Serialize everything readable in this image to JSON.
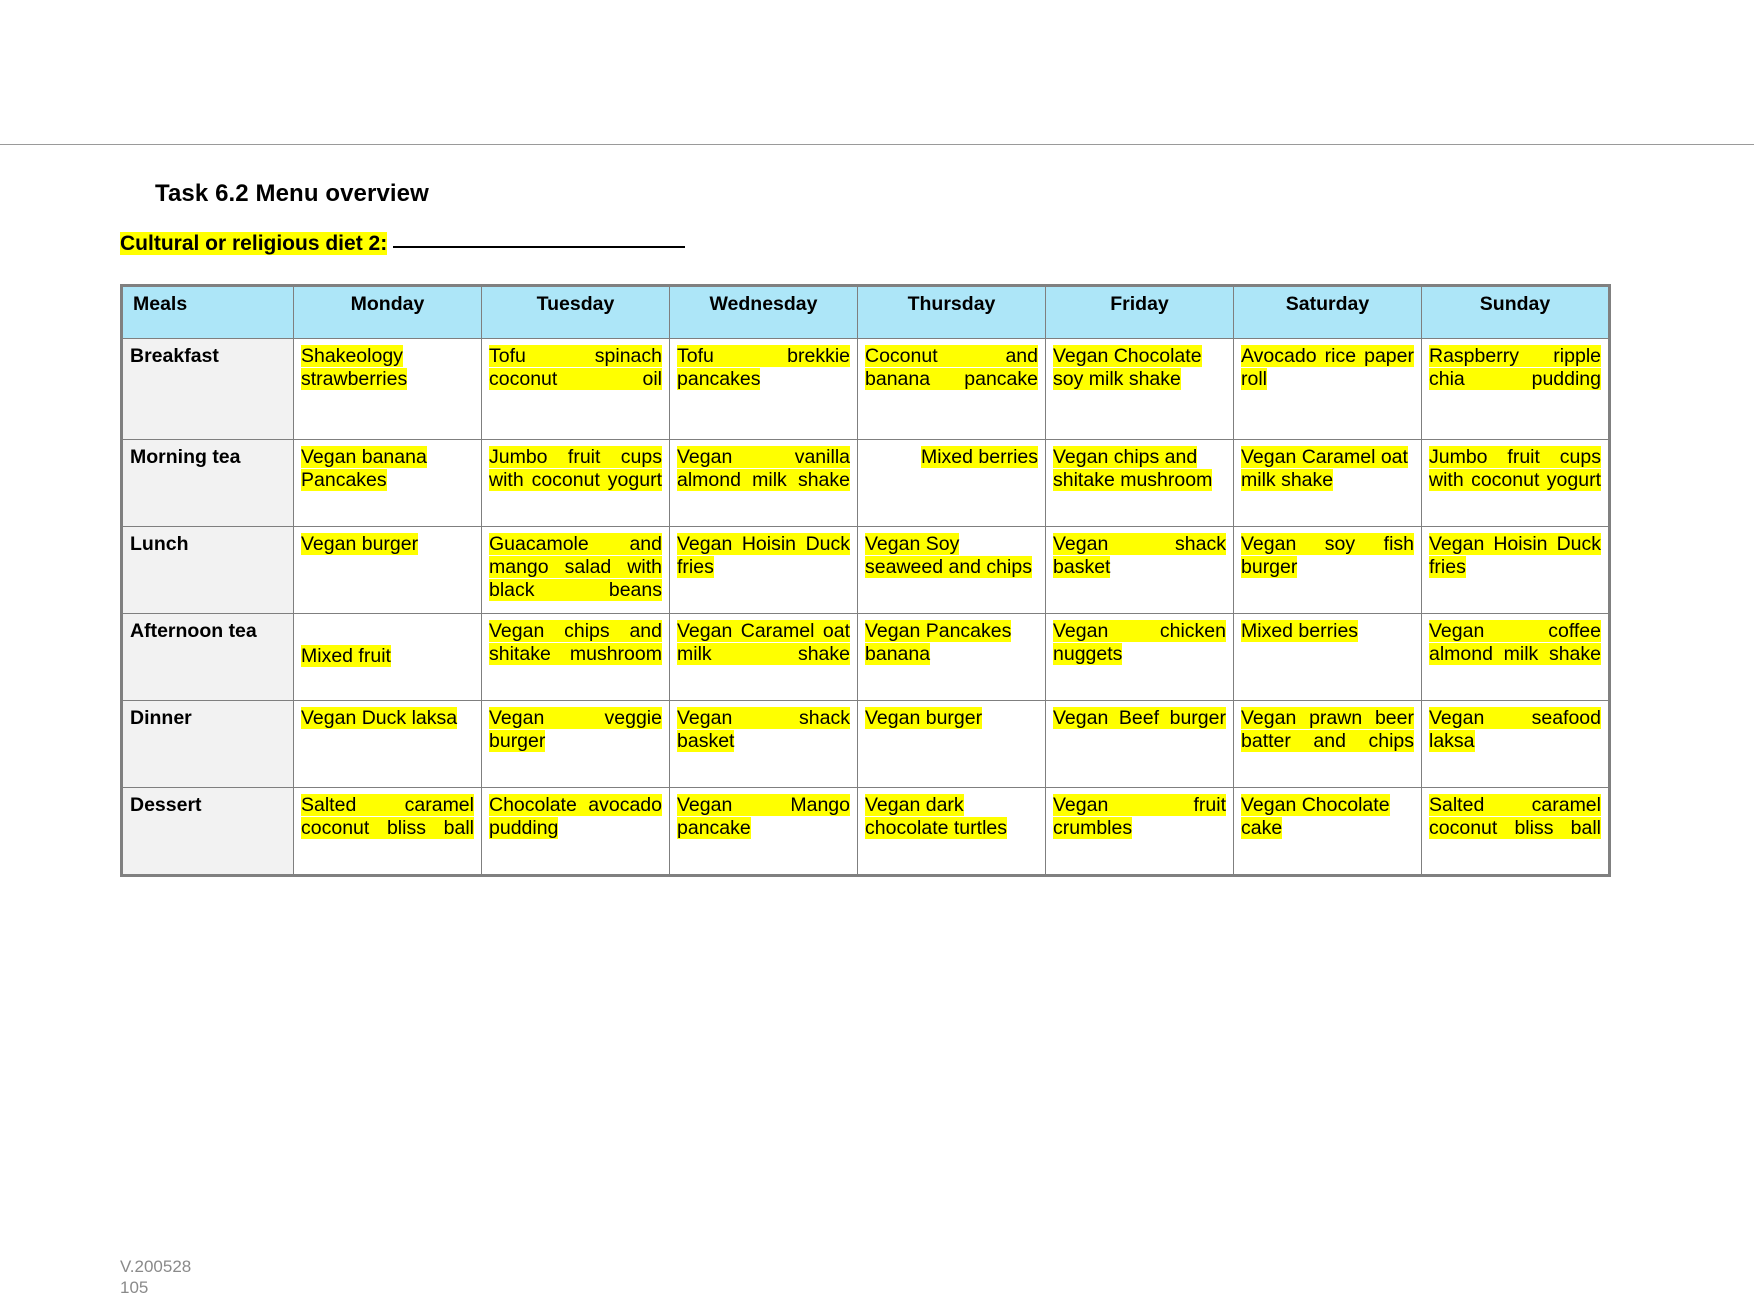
{
  "document": {
    "task_title": "Task 6.2 Menu overview",
    "diet_label": "Cultural or religious diet 2:",
    "diet_value": "",
    "footer_version": "V.200528",
    "footer_page": "105"
  },
  "colors": {
    "header_fill": "#ade6f8",
    "meal_label_fill": "#f2f2f2",
    "highlight": "#ffff00",
    "table_border": "#7f7f7f",
    "table_outer_border": "#808080",
    "footer_text": "#8a8a8a"
  },
  "table": {
    "columns": [
      "Meals",
      "Monday",
      "Tuesday",
      "Wednesday",
      "Thursday",
      "Friday",
      "Saturday",
      "Sunday"
    ],
    "rows": [
      {
        "meal": "Breakfast",
        "cells": [
          "Shakeology strawberries",
          "Tofu spinach coconut oil",
          "Tofu brekkie pancakes",
          "Coconut and banana pancake",
          "Vegan Chocolate soy milk shake",
          "Avocado rice paper roll",
          "Raspberry ripple chia pudding"
        ]
      },
      {
        "meal": "Morning tea",
        "cells": [
          "Vegan banana Pancakes",
          "Jumbo fruit cups with coconut yogurt",
          "Vegan vanilla almond milk shake",
          "Mixed berries",
          "Vegan chips and shitake mushroom",
          "Vegan Caramel oat milk shake",
          "Jumbo fruit cups with coconut yogurt"
        ]
      },
      {
        "meal": "Lunch",
        "cells": [
          "Vegan burger",
          "Guacamole and mango salad with black beans",
          "Vegan Hoisin Duck fries",
          "Vegan Soy seaweed and chips",
          "Vegan shack basket",
          "Vegan soy fish burger",
          "Vegan Hoisin Duck fries"
        ]
      },
      {
        "meal": "Afternoon tea",
        "cells": [
          "Mixed fruit",
          "Vegan chips and shitake mushroom",
          "Vegan Caramel oat milk shake",
          "Vegan Pancakes banana",
          "Vegan chicken nuggets",
          "Mixed berries",
          "Vegan coffee almond milk shake"
        ]
      },
      {
        "meal": "Dinner",
        "cells": [
          "Vegan Duck laksa",
          "Vegan veggie burger",
          "Vegan shack basket",
          "Vegan burger",
          "Vegan Beef burger",
          "Vegan prawn beer batter and chips",
          "Vegan seafood laksa"
        ]
      },
      {
        "meal": "Dessert",
        "cells": [
          "Salted caramel coconut bliss ball",
          "Chocolate avocado pudding",
          "Vegan Mango pancake",
          "Vegan dark chocolate turtles",
          "Vegan fruit crumbles",
          "Vegan Chocolate cake",
          "Salted caramel coconut bliss ball"
        ]
      }
    ]
  }
}
